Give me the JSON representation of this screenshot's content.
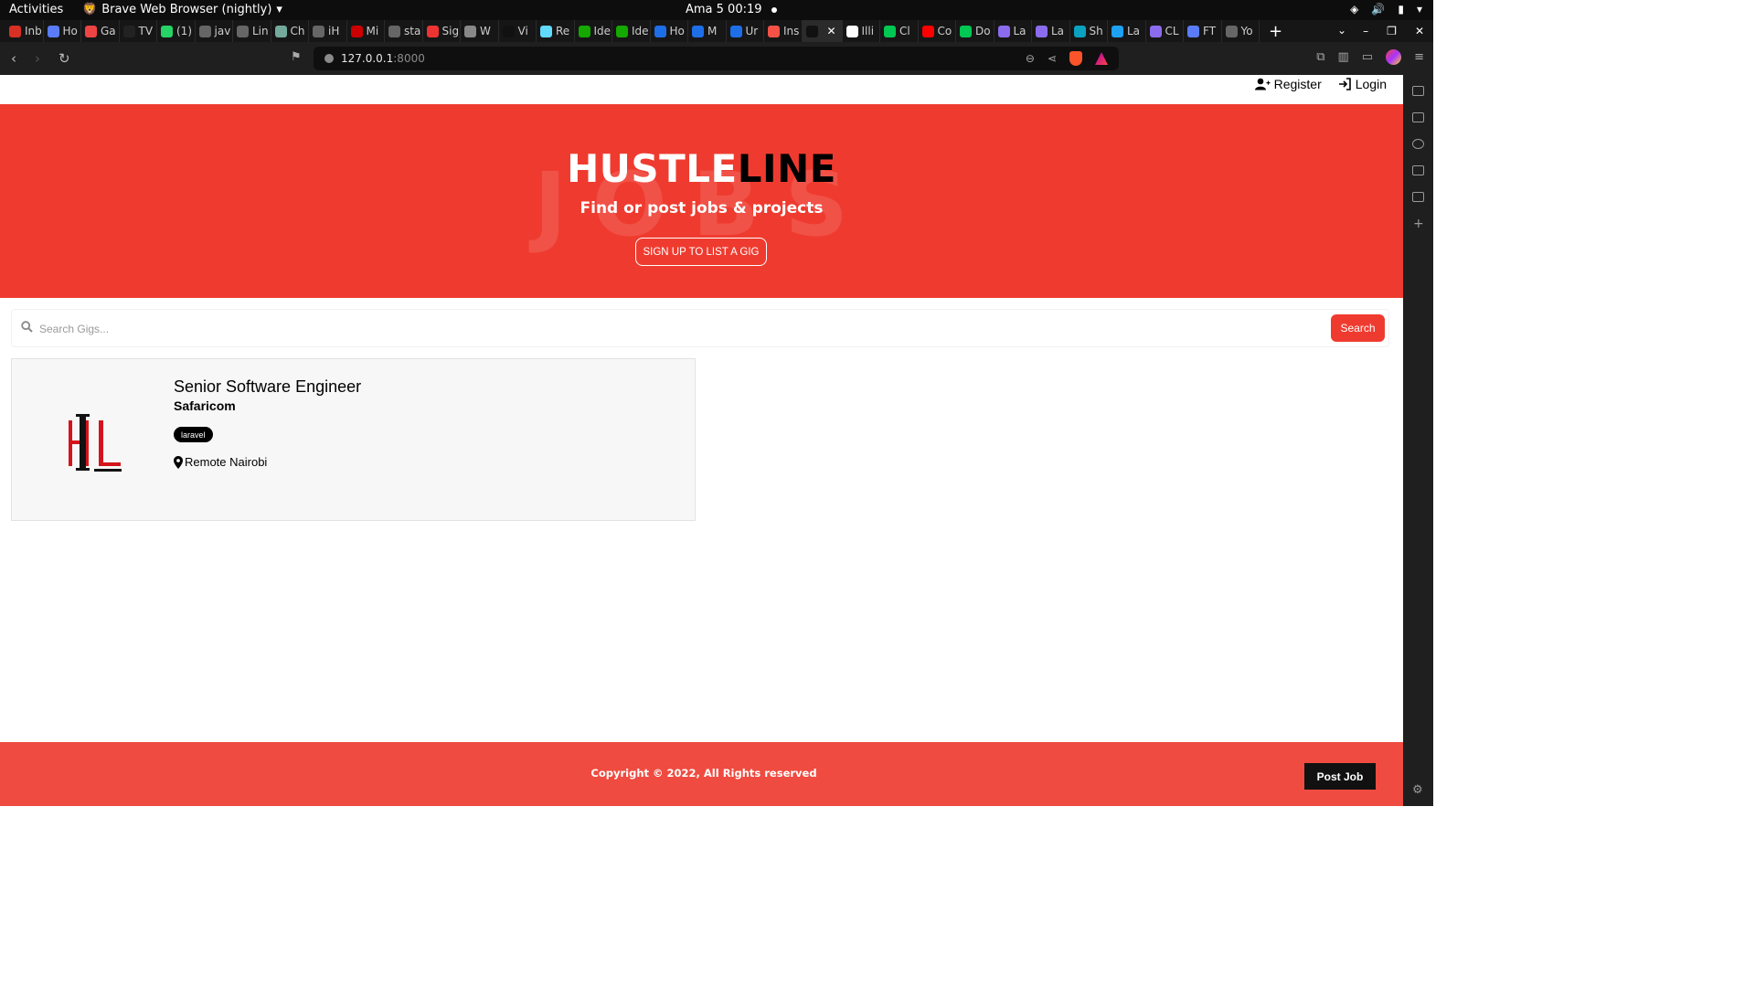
{
  "os_bar": {
    "activities": "Activities",
    "app_name": "Brave Web Browser (nightly)",
    "clock": "Ama 5  00:19"
  },
  "tabs": [
    {
      "label": "Inb",
      "icon": "gmail-icon",
      "color": "#d93025"
    },
    {
      "label": "Ho",
      "icon": "infinity-icon",
      "color": "#5b7cfa"
    },
    {
      "label": "Ga",
      "icon": "image-icon",
      "color": "#e44"
    },
    {
      "label": "TV",
      "icon": "tv-icon",
      "color": "#222"
    },
    {
      "label": "(1)",
      "icon": "whatsapp-icon",
      "color": "#25d366"
    },
    {
      "label": "jav",
      "icon": "globe-icon",
      "color": "#666"
    },
    {
      "label": "Lin",
      "icon": "globe-icon",
      "color": "#666"
    },
    {
      "label": "Ch",
      "icon": "chatgpt-icon",
      "color": "#74aa9c"
    },
    {
      "label": "iH",
      "icon": "globe-icon",
      "color": "#666"
    },
    {
      "label": "Mi",
      "icon": "news-icon",
      "color": "#c00"
    },
    {
      "label": "sta",
      "icon": "globe-icon",
      "color": "#666"
    },
    {
      "label": "Sig",
      "icon": "target-icon",
      "color": "#e33"
    },
    {
      "label": "W",
      "icon": "cloud-icon",
      "color": "#888"
    },
    {
      "label": "Vi",
      "icon": "s-icon",
      "color": "#111"
    },
    {
      "label": "Re",
      "icon": "react-icon",
      "color": "#61dafb"
    },
    {
      "label": "Ide",
      "icon": "upwork-icon",
      "color": "#14a800"
    },
    {
      "label": "Ide",
      "icon": "upwork-icon",
      "color": "#14a800"
    },
    {
      "label": "Ho",
      "icon": "c-icon",
      "color": "#1e6ee8"
    },
    {
      "label": "M",
      "icon": "c-icon",
      "color": "#1e6ee8"
    },
    {
      "label": "Ur",
      "icon": "c-icon",
      "color": "#1e6ee8"
    },
    {
      "label": "Ins",
      "icon": "laravel-icon",
      "color": "#f55247"
    },
    {
      "label": "",
      "icon": "hustleline-icon",
      "color": "#111",
      "active": true
    },
    {
      "label": "Illi",
      "icon": "github-icon",
      "color": "#fff"
    },
    {
      "label": "Cl",
      "icon": "leaf-icon",
      "color": "#00c853"
    },
    {
      "label": "Co",
      "icon": "youtube-icon",
      "color": "#f00"
    },
    {
      "label": "Do",
      "icon": "leaf-icon",
      "color": "#00c853"
    },
    {
      "label": "La",
      "icon": "obsidian-icon",
      "color": "#8b6cef"
    },
    {
      "label": "La",
      "icon": "obsidian-icon",
      "color": "#8b6cef"
    },
    {
      "label": "Sh",
      "icon": "swirl-icon",
      "color": "#0aa2c0"
    },
    {
      "label": "La",
      "icon": "w-icon",
      "color": "#1da1f2"
    },
    {
      "label": "CL",
      "icon": "obsidian-icon",
      "color": "#8b6cef"
    },
    {
      "label": "FT",
      "icon": "infinity-icon",
      "color": "#5b7cfa"
    },
    {
      "label": "Yo",
      "icon": "globe-icon",
      "color": "#666"
    }
  ],
  "address": {
    "host": "127.0.0.1",
    "port": ":8000"
  },
  "site_nav": {
    "register": "Register",
    "login": "Login"
  },
  "hero": {
    "brand_white": "HUSTLE",
    "brand_black": "LINE",
    "watermark": "JOBS",
    "tagline": "Find or post jobs & projects",
    "cta": "SIGN UP TO LIST A GIG"
  },
  "search": {
    "placeholder": "Search Gigs...",
    "button": "Search"
  },
  "listings": [
    {
      "title": "Senior Software Engineer",
      "company": "Safaricom",
      "tags": [
        "laravel"
      ],
      "location": "Remote Nairobi"
    }
  ],
  "footer": {
    "copyright": "Copyright © 2022, All Rights reserved",
    "post_job": "Post Job"
  },
  "colors": {
    "brand_red": "#ef3b2f",
    "footer_red": "#ef4b40"
  }
}
